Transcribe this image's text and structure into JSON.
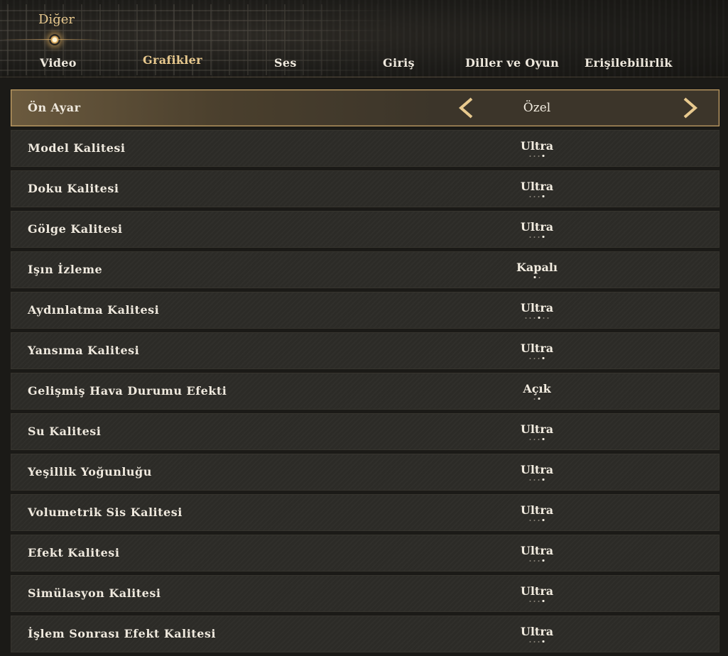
{
  "header": {
    "category": "Diğer",
    "tabs": [
      {
        "label": "Video",
        "active": false
      },
      {
        "label": "Grafikler",
        "active": true
      },
      {
        "label": "Ses",
        "active": false
      },
      {
        "label": "Giriş",
        "active": false
      },
      {
        "label": "Diller ve Oyun",
        "active": false
      },
      {
        "label": "Erişilebilirlik",
        "active": false
      }
    ]
  },
  "colors": {
    "accent": "#e8c98e",
    "selected_border": "#c8a468",
    "row_bg": "#2c2b27",
    "text": "#efe9de"
  },
  "settings": [
    {
      "label": "Ön Ayar",
      "value": "Özel",
      "selected": true,
      "arrows": true
    },
    {
      "label": "Model Kalitesi",
      "value": "Ultra",
      "options": 4,
      "index": 3
    },
    {
      "label": "Doku Kalitesi",
      "value": "Ultra",
      "options": 4,
      "index": 3
    },
    {
      "label": "Gölge Kalitesi",
      "value": "Ultra",
      "options": 4,
      "index": 3
    },
    {
      "label": "Işın İzleme",
      "value": "Kapalı",
      "options": 2,
      "index": 0
    },
    {
      "label": "Aydınlatma Kalitesi",
      "value": "Ultra",
      "options": 6,
      "index": 3
    },
    {
      "label": "Yansıma Kalitesi",
      "value": "Ultra",
      "options": 4,
      "index": 3
    },
    {
      "label": "Gelişmiş Hava Durumu Efekti",
      "value": "Açık",
      "options": 2,
      "index": 1
    },
    {
      "label": "Su Kalitesi",
      "value": "Ultra",
      "options": 4,
      "index": 3
    },
    {
      "label": "Yeşillik Yoğunluğu",
      "value": "Ultra",
      "options": 4,
      "index": 3
    },
    {
      "label": "Volumetrik Sis Kalitesi",
      "value": "Ultra",
      "options": 4,
      "index": 3
    },
    {
      "label": "Efekt Kalitesi",
      "value": "Ultra",
      "options": 4,
      "index": 3
    },
    {
      "label": "Simülasyon Kalitesi",
      "value": "Ultra",
      "options": 4,
      "index": 3
    },
    {
      "label": "İşlem Sonrası Efekt Kalitesi",
      "value": "Ultra",
      "options": 4,
      "index": 3
    }
  ]
}
